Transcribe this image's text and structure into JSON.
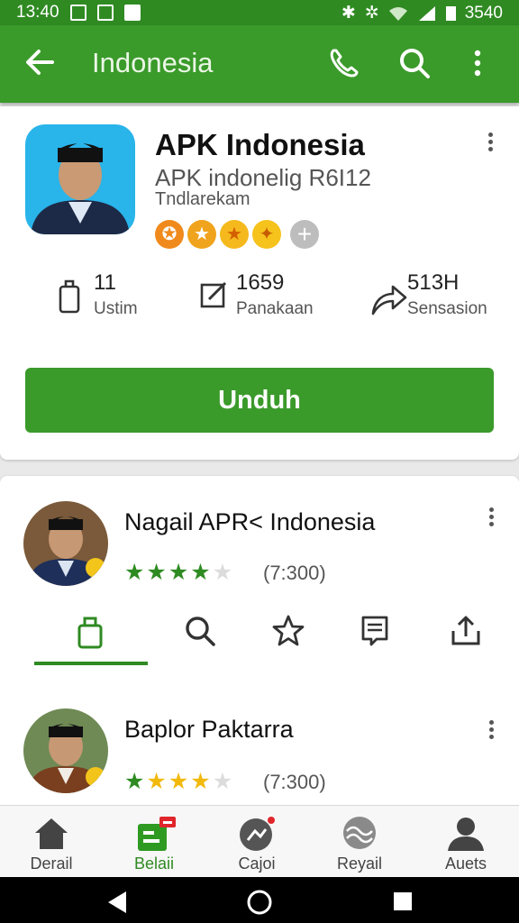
{
  "status_bar": {
    "time": "13:40",
    "battery": "3540"
  },
  "app_bar": {
    "title": "Indonesia"
  },
  "app": {
    "name": "APK Indonesia",
    "subtitle": "APK indonelig R6I12",
    "developer": "Tndlarekam",
    "stats": [
      {
        "value": "11",
        "label": "Ustim",
        "icon": "device-icon"
      },
      {
        "value": "1659",
        "label": "Panakaan",
        "icon": "edit-icon"
      },
      {
        "value": "513H",
        "label": "Sensasion",
        "icon": "share-arrow-icon"
      }
    ],
    "install_label": "Unduh"
  },
  "reviews": [
    {
      "name": "Nagail APR< Indonesia",
      "rating": 4,
      "count": "(7:300)"
    },
    {
      "name": "Baplor Paktarra",
      "rating": 4,
      "count": "(7:300)"
    }
  ],
  "tabs": [
    "device-icon",
    "search-icon",
    "star-icon",
    "feedback-icon",
    "upload-icon"
  ],
  "bottom_nav": [
    {
      "label": "Derail",
      "icon": "home-icon"
    },
    {
      "label": "Belaii",
      "icon": "apps-icon",
      "active": true
    },
    {
      "label": "Cajoi",
      "icon": "games-icon"
    },
    {
      "label": "Reyail",
      "icon": "waves-icon"
    },
    {
      "label": "Auets",
      "icon": "account-icon"
    }
  ],
  "colors": {
    "primary": "#3a9a2a",
    "status_bar": "#2f8a22",
    "star_green": "#2e8b22",
    "star_yellow": "#f2b90d"
  }
}
